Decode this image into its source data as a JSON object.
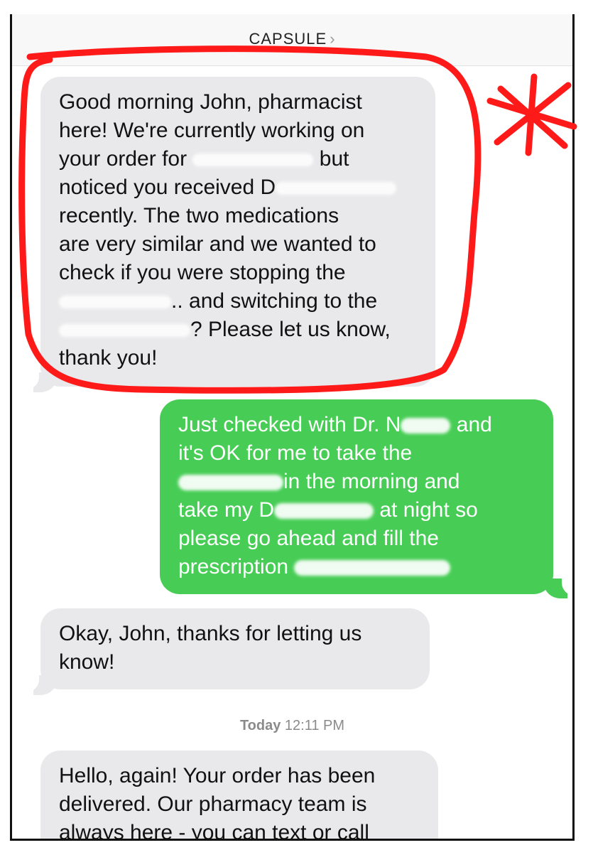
{
  "header": {
    "contact_name": "CAPSULE",
    "chevron_icon": "chevron-right-icon"
  },
  "messages": [
    {
      "direction": "incoming",
      "lines": [
        "Good morning John, pharmacist",
        "here! We're currently working on",
        "your order for",
        "but",
        "noticed you received D",
        "recently. The two medications",
        "are very similar and we wanted to",
        "check if you were stopping the",
        ".. and switching to the",
        "? Please let us know,",
        "thank you!"
      ]
    },
    {
      "direction": "outgoing",
      "lines": [
        "Just checked with Dr. N",
        "and",
        "it's OK for me to take the",
        "in the morning and",
        "take my D",
        "at night so",
        "please go ahead and fill the",
        "prescription"
      ]
    },
    {
      "direction": "incoming",
      "lines": [
        "Okay, John, thanks for letting us",
        "know!"
      ]
    },
    {
      "direction": "incoming",
      "lines": [
        "Hello, again! Your order has been",
        "delivered. Our pharmacy team is",
        "always here - you can text or call"
      ]
    }
  ],
  "timestamp": {
    "day": "Today",
    "time": "12:11 PM"
  },
  "colors": {
    "incoming_bubble": "#e9e9eb",
    "outgoing_bubble": "#47cd55",
    "annotation": "#ff1a1a"
  }
}
